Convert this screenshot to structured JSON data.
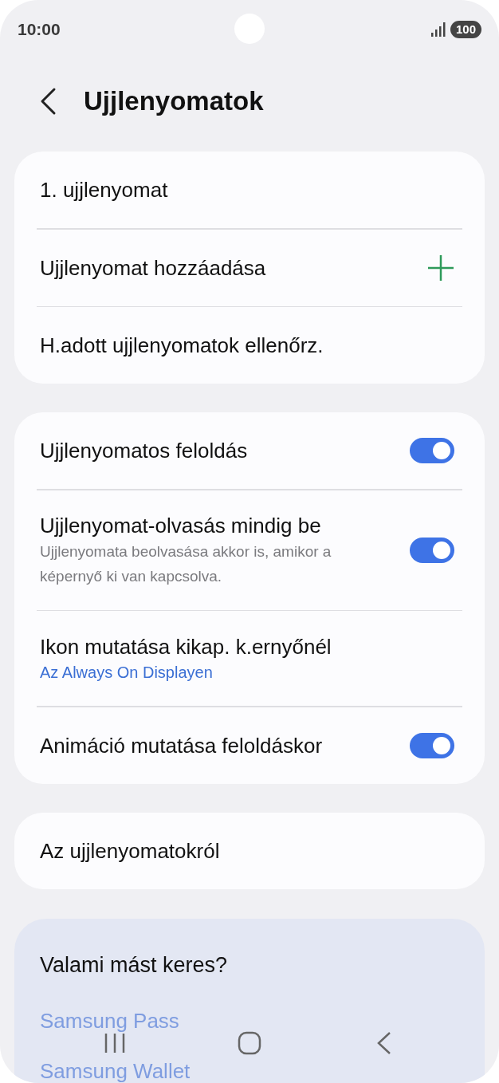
{
  "status_bar": {
    "time": "10:00",
    "battery": "100"
  },
  "header": {
    "title": "Ujjlenyomatok"
  },
  "groups": [
    {
      "items": [
        {
          "kind": "plain",
          "title": "1. ujjlenyomat"
        },
        {
          "kind": "add",
          "title": "Ujjlenyomat hozzáadása"
        },
        {
          "kind": "plain",
          "title": "H.adott ujjlenyomatok ellenőrz."
        }
      ]
    },
    {
      "items": [
        {
          "kind": "toggle",
          "title": "Ujjlenyomatos feloldás",
          "on": true
        },
        {
          "kind": "toggle",
          "title": "Ujjlenyomat-olvasás mindig be",
          "subtitle": "Ujjlenyomata beolvasása akkor is, amikor a képernyő ki van kapcsolva.",
          "on": true
        },
        {
          "kind": "link",
          "title": "Ikon mutatása kikap. k.ernyőnél",
          "link": "Az Always On Displayen"
        },
        {
          "kind": "toggle",
          "title": "Animáció mutatása feloldáskor",
          "on": true
        }
      ]
    },
    {
      "items": [
        {
          "kind": "plain",
          "title": "Az ujjlenyomatokról"
        }
      ]
    }
  ],
  "suggestions": {
    "title": "Valami mást keres?",
    "links": [
      "Samsung Pass",
      "Samsung Wallet"
    ]
  }
}
